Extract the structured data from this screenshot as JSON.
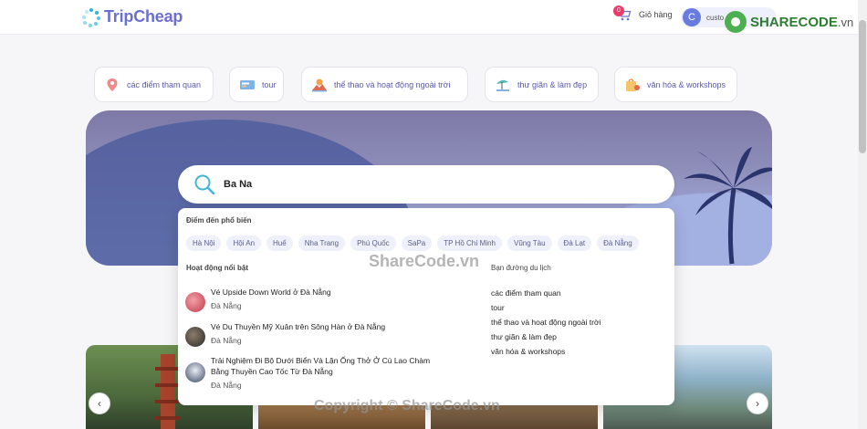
{
  "header": {
    "logo_text": "TripCheap",
    "cart_label": "Giỏ hàng",
    "cart_count": "0",
    "avatar_initial": "C",
    "user_name": "custo"
  },
  "categories": [
    {
      "label": "các điểm tham quan",
      "icon": "map-pin-icon"
    },
    {
      "label": "tour",
      "icon": "ticket-icon"
    },
    {
      "label": "thể thao và hoạt động ngoài trời",
      "icon": "outdoor-icon"
    },
    {
      "label": "thư giãn & làm đẹp",
      "icon": "beach-chair-icon"
    },
    {
      "label": "văn hóa & workshops",
      "icon": "culture-bag-icon"
    }
  ],
  "search": {
    "value": "Ba Na"
  },
  "dropdown": {
    "popular_title": "Điểm đến phổ biến",
    "popular_destinations": [
      "Hà Nội",
      "Hội An",
      "Huế",
      "Nha Trang",
      "Phú Quốc",
      "SaPa",
      "TP Hồ Chí Minh",
      "Vũng Tàu",
      "Đà Lạt",
      "Đà Nẵng"
    ],
    "activities_title": "Hoạt động nổi bật",
    "activities": [
      {
        "title": "Vé Upside Down World ở Đà Nẵng",
        "location": "Đà Nẵng"
      },
      {
        "title": "Vé Du Thuyền Mỹ Xuân trên Sông Hàn ở Đà Nẵng",
        "location": "Đà Nẵng"
      },
      {
        "title": "Trải Nghiệm Đi Bộ Dưới Biển Và Lặn Ống Thở Ở Cù Lao Chàm Bằng Thuyền Cao Tốc Từ Đà Nẵng",
        "location": "Đà Nẵng"
      }
    ],
    "guide_title": "Bạn đường du lịch",
    "guide_items": [
      "các điểm tham quan",
      "tour",
      "thể thao và hoạt động ngoài trời",
      "thư giãn & làm đẹp",
      "văn hóa & workshops"
    ]
  },
  "carousel": {
    "prev": "‹",
    "next": "›"
  },
  "watermarks": {
    "logo_main": "SHARECODE",
    "logo_suffix": ".vn",
    "center": "ShareCode.vn",
    "bottom": "Copyright © ShareCode.vn"
  },
  "colors": {
    "brand": "#6b6fd0",
    "accent": "#2bb5e0",
    "badge": "#e83d6b"
  }
}
